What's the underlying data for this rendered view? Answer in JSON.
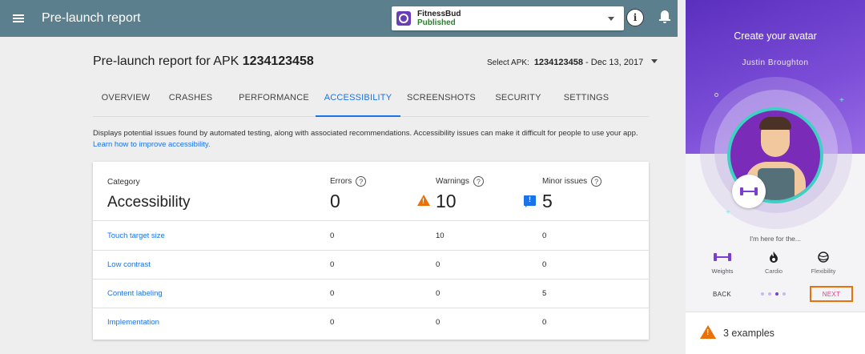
{
  "topbar": {
    "title": "Pre-launch report",
    "app_name": "FitnessBud",
    "app_status": "Published"
  },
  "main": {
    "heading_prefix": "Pre-launch report for APK ",
    "heading_apk": "1234123458",
    "apk_select_label": "Select APK:",
    "apk_select_number": "1234123458",
    "apk_select_date": " - Dec 13, 2017",
    "tabs": [
      "OVERVIEW",
      "CRASHES",
      "PERFORMANCE",
      "ACCESSIBILITY",
      "SCREENSHOTS",
      "SECURITY",
      "SETTINGS"
    ],
    "active_tab": "ACCESSIBILITY",
    "description": "Displays potential issues found by automated testing, along with associated recommendations. Accessibility issues can make it difficult for people to use your app.",
    "learn_link": "Learn how to improve accessibility."
  },
  "summary": {
    "category_label": "Category",
    "category_value": "Accessibility",
    "errors_label": "Errors",
    "errors_value": "0",
    "warnings_label": "Warnings",
    "warnings_value": "10",
    "minor_label": "Minor issues",
    "minor_value": "5",
    "help_glyph": "?",
    "warn_glyph": "!"
  },
  "rows": [
    {
      "name": "Touch target size",
      "errors": "0",
      "warnings": "10",
      "minor": "0"
    },
    {
      "name": "Low contrast",
      "errors": "0",
      "warnings": "0",
      "minor": "0"
    },
    {
      "name": "Content labeling",
      "errors": "0",
      "warnings": "0",
      "minor": "5"
    },
    {
      "name": "Implementation",
      "errors": "0",
      "warnings": "0",
      "minor": "0"
    }
  ],
  "phone": {
    "title": "Create your avatar",
    "user_name": "Justin Broughton",
    "here_for": "I'm here for the...",
    "options": [
      {
        "label": "Weights",
        "icon": "dumbbell-icon"
      },
      {
        "label": "Cardio",
        "icon": "flame-icon"
      },
      {
        "label": "Flexibility",
        "icon": "yoga-ball-icon"
      }
    ],
    "back_label": "BACK",
    "next_label": "NEXT",
    "examples_text": "3 examples",
    "accent_color": "#7a3fd0",
    "highlight_color": "#e8710a"
  }
}
